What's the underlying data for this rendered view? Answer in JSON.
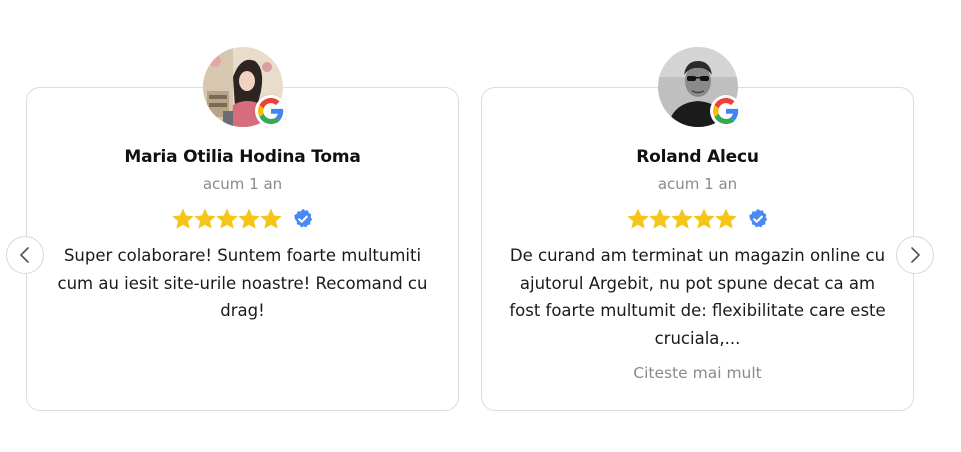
{
  "carousel": {
    "prev_icon": "chevron-left-icon",
    "next_icon": "chevron-right-icon"
  },
  "reviews": [
    {
      "name": "Maria Otilia Hodina Toma",
      "date": "acum 1 an",
      "rating": 5,
      "verified": true,
      "source": "google-icon",
      "text": "Super colaborare! Suntem foarte multumiti cum au iesit site-urile noastre! Recomand cu drag!"
    },
    {
      "name": "Roland Alecu",
      "date": "acum 1 an",
      "rating": 5,
      "verified": true,
      "source": "google-icon",
      "text": "De curand am terminat un magazin online cu ajutorul Argebit, nu pot spune decat ca am fost foarte multumit de: flexibilitate care este cruciala,...",
      "read_more": "Citeste mai mult"
    }
  ],
  "colors": {
    "star": "#f5c518",
    "verified": "#4a89f3",
    "muted_text": "#8a8a8a",
    "border": "#dcdcdc"
  }
}
